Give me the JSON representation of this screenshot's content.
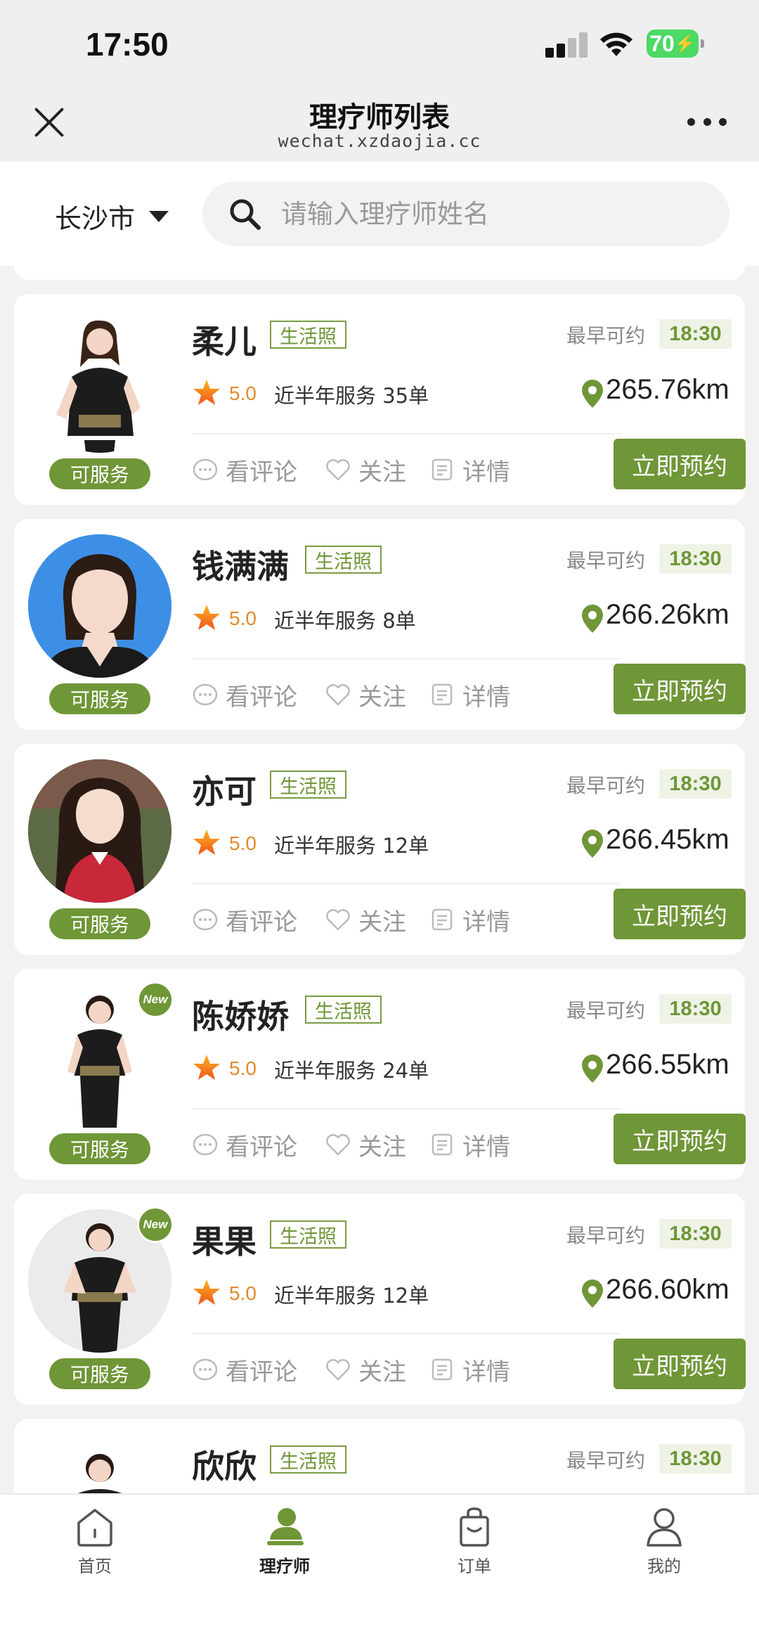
{
  "status_bar": {
    "time": "17:50",
    "battery": "70"
  },
  "nav": {
    "title": "理疗师列表",
    "subtitle": "wechat.xzdaojia.cc"
  },
  "search": {
    "city": "长沙市",
    "placeholder": "请输入理疗师姓名"
  },
  "labels": {
    "photo_tag": "生活照",
    "earliest": "最早可约",
    "service_prefix": "近半年服务",
    "status": "可服务",
    "review": "看评论",
    "follow": "关注",
    "detail": "详情",
    "book": "立即预约",
    "new_badge": "New"
  },
  "therapists": [
    {
      "name": "柔儿",
      "slot": "18:30",
      "rating": "5.0",
      "orders": "近半年服务 35单",
      "distance": "265.76km",
      "is_new": false
    },
    {
      "name": "钱满满",
      "slot": "18:30",
      "rating": "5.0",
      "orders": "近半年服务 8单",
      "distance": "266.26km",
      "is_new": false
    },
    {
      "name": "亦可",
      "slot": "18:30",
      "rating": "5.0",
      "orders": "近半年服务 12单",
      "distance": "266.45km",
      "is_new": false
    },
    {
      "name": "陈娇娇",
      "slot": "18:30",
      "rating": "5.0",
      "orders": "近半年服务 24单",
      "distance": "266.55km",
      "is_new": true
    },
    {
      "name": "果果",
      "slot": "18:30",
      "rating": "5.0",
      "orders": "近半年服务 12单",
      "distance": "266.60km",
      "is_new": true
    },
    {
      "name": "欣欣",
      "slot": "18:30"
    }
  ],
  "tabbar": [
    {
      "label": "首页",
      "icon": "home-icon"
    },
    {
      "label": "理疗师",
      "icon": "therapist-icon",
      "active": true
    },
    {
      "label": "订单",
      "icon": "order-bag-icon"
    },
    {
      "label": "我的",
      "icon": "profile-icon"
    }
  ],
  "colors": {
    "brand_green": "#6f9637",
    "rating_orange": "#e08a2c"
  }
}
